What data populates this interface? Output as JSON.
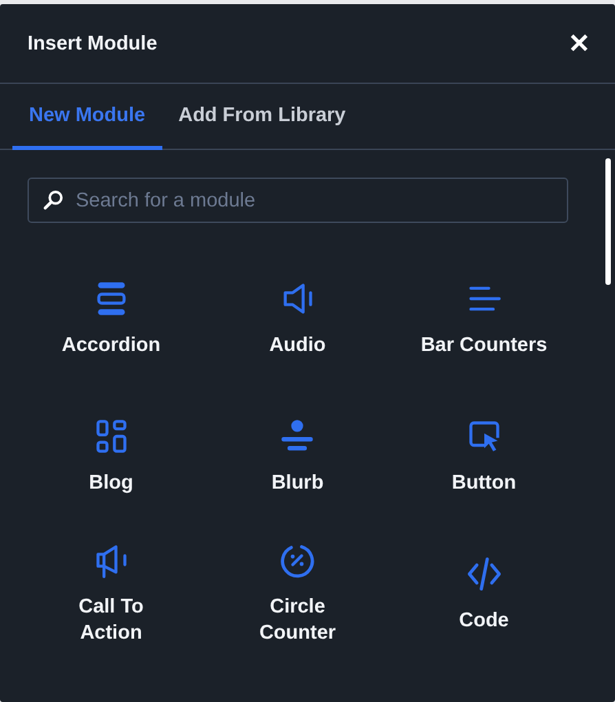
{
  "window": {
    "title": "Insert Module",
    "close": "✕"
  },
  "tabs": [
    {
      "label": "New Module",
      "selected": true
    },
    {
      "label": "Add From Library",
      "selected": false
    }
  ],
  "search": {
    "placeholder": "Search for a module"
  },
  "modules": [
    {
      "label": "Accordion",
      "kind": "accordion"
    },
    {
      "label": "Audio",
      "kind": "audio"
    },
    {
      "label": "Bar Counters",
      "kind": "bars"
    },
    {
      "label": "Blog",
      "kind": "blog"
    },
    {
      "label": "Blurb",
      "kind": "blurb"
    },
    {
      "label": "Button",
      "kind": "button"
    },
    {
      "label": "Call To\nAction",
      "kind": "cta"
    },
    {
      "label": "Circle\nCounter",
      "kind": "circle"
    },
    {
      "label": "Code",
      "kind": "code"
    }
  ]
}
